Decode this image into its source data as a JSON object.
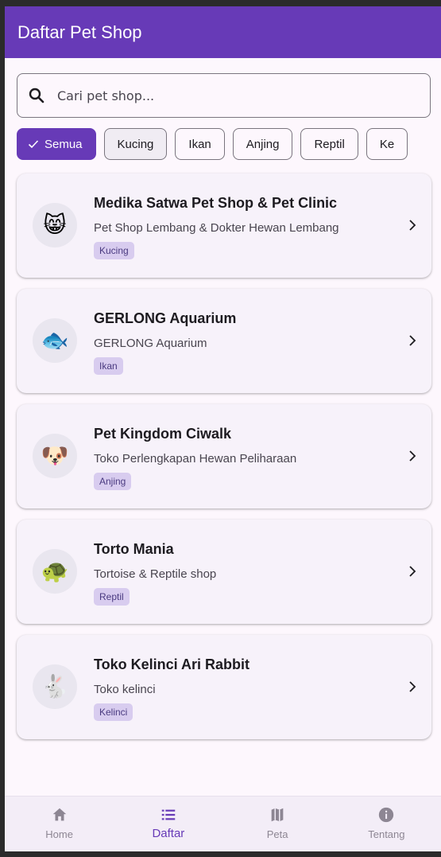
{
  "appbar": {
    "title": "Daftar Pet Shop"
  },
  "search": {
    "placeholder": "Cari pet shop..."
  },
  "chips": [
    {
      "label": "Semua",
      "selected": true
    },
    {
      "label": "Kucing"
    },
    {
      "label": "Ikan"
    },
    {
      "label": "Anjing"
    },
    {
      "label": "Reptil"
    },
    {
      "label": "Ke"
    }
  ],
  "shops": [
    {
      "name": "Medika Satwa Pet Shop & Pet Clinic",
      "subtitle": "Pet Shop Lembang & Dokter Hewan Lembang",
      "tag": "Kucing",
      "emoji": "😸"
    },
    {
      "name": "GERLONG Aquarium",
      "subtitle": "GERLONG Aquarium",
      "tag": "Ikan",
      "emoji": "🐟"
    },
    {
      "name": "Pet Kingdom Ciwalk",
      "subtitle": "Toko Perlengkapan Hewan Peliharaan",
      "tag": "Anjing",
      "emoji": "🐶"
    },
    {
      "name": "Torto Mania",
      "subtitle": "Tortoise & Reptile shop",
      "tag": "Reptil",
      "emoji": "🐢"
    },
    {
      "name": "Toko Kelinci Ari Rabbit",
      "subtitle": "Toko kelinci",
      "tag": "Kelinci",
      "emoji": "🐇"
    }
  ],
  "nav": [
    {
      "label": "Home",
      "icon": "home-icon"
    },
    {
      "label": "Daftar",
      "icon": "list-icon",
      "active": true
    },
    {
      "label": "Peta",
      "icon": "map-icon"
    },
    {
      "label": "Tentang",
      "icon": "info-icon"
    }
  ],
  "colors": {
    "primary": "#673ab7",
    "background": "#fdf7fd",
    "card": "#f7f2fa",
    "tag": "#d8ccef"
  }
}
